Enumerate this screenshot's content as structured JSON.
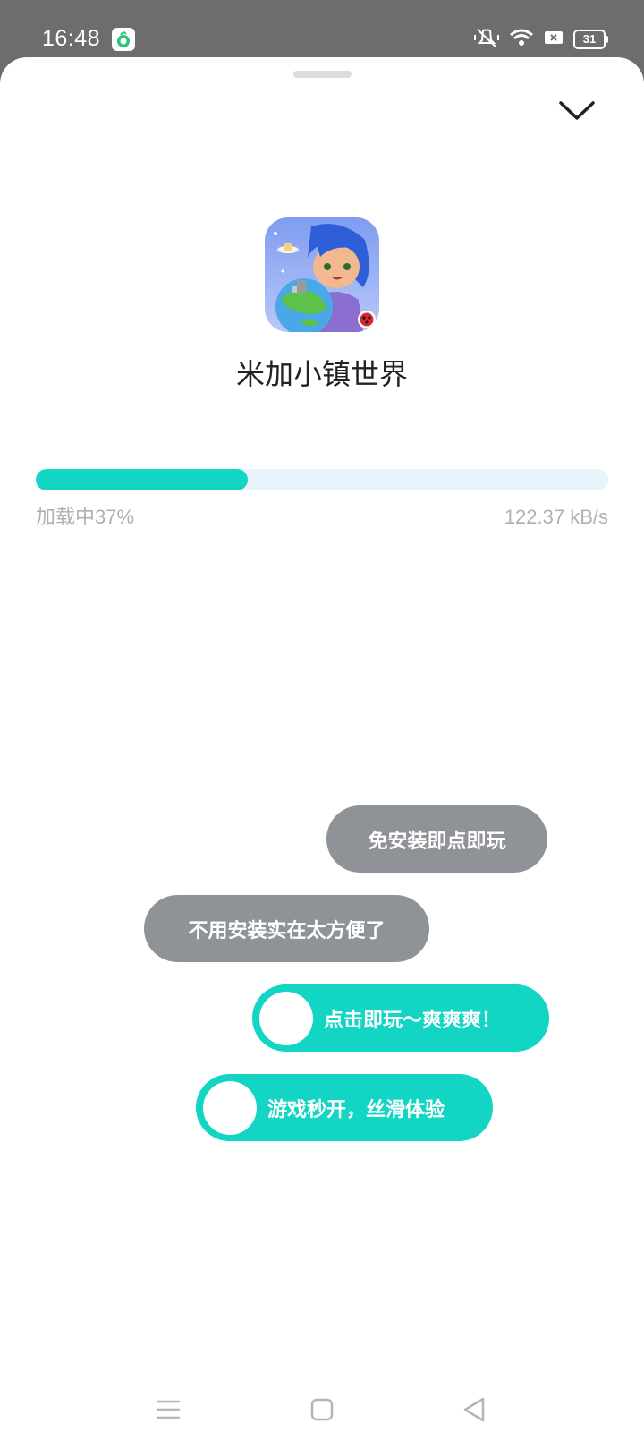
{
  "status_bar": {
    "time": "16:48",
    "battery": "31",
    "icons": [
      "app-notification-icon",
      "mute-icon",
      "wifi-icon",
      "no-sim-icon",
      "battery-icon"
    ]
  },
  "sheet": {
    "collapse_icon": "chevron-down-icon",
    "app": {
      "name": "米加小镇世界",
      "icon": "app-icon"
    },
    "download": {
      "progress": 0.37,
      "status_text": "加载中37%",
      "speed_text": "122.37 kB/s"
    },
    "bubbles": [
      {
        "text": "免安装即点即玩",
        "style": "gray"
      },
      {
        "text": "不用安装实在太方便了",
        "style": "gray"
      },
      {
        "text": "点击即玩～爽爽爽！",
        "style": "teal"
      },
      {
        "text": "游戏秒开，丝滑体验",
        "style": "teal"
      }
    ]
  },
  "nav_bar": {
    "buttons": [
      "menu-icon",
      "home-icon",
      "back-icon"
    ]
  },
  "colors": {
    "accent": "#12d6c3",
    "progress_track": "#e8f4fb",
    "gray_bubble": "#8f9297",
    "status_bar_bg": "#6d6d6d"
  }
}
